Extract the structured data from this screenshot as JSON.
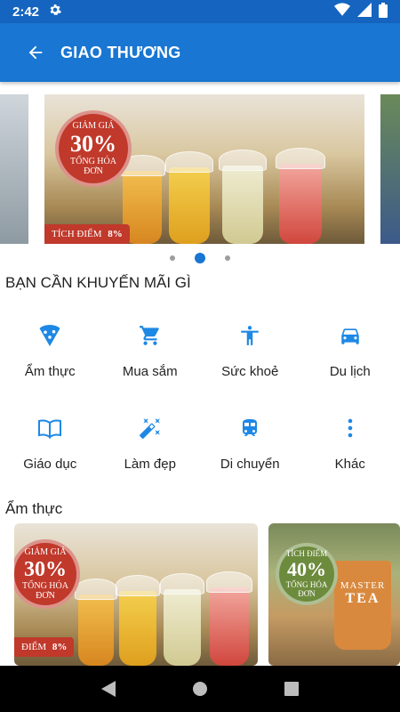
{
  "status_bar": {
    "time": "2:42",
    "icons": [
      "gear-icon",
      "wifi-icon",
      "signal-icon",
      "battery-icon"
    ]
  },
  "app_bar": {
    "title": "GIAO THƯƠNG",
    "back_icon": "arrow-back-icon"
  },
  "colors": {
    "primary": "#1976d2",
    "primary_dark": "#1565c0",
    "icon_blue": "#1e88e5",
    "promo_red": "#c0392b",
    "promo_green": "#6d8b3d"
  },
  "carousel": {
    "slide_count": 3,
    "active_index": 1,
    "banner": {
      "badge_line1": "GIẢM GIÁ",
      "badge_value": "30%",
      "badge_line3": "TỔNG HÓA",
      "badge_line4": "ĐƠN",
      "tag_label": "TÍCH ĐIỂM",
      "tag_value": "8%"
    }
  },
  "categories_section": {
    "title": "BẠN CẦN KHUYẾN MÃI GÌ",
    "items": [
      {
        "label": "Ẩm thực",
        "icon": "pizza-icon"
      },
      {
        "label": "Mua sắm",
        "icon": "cart-icon"
      },
      {
        "label": "Sức khoẻ",
        "icon": "person-icon"
      },
      {
        "label": "Du lịch",
        "icon": "car-icon"
      },
      {
        "label": "Giáo dục",
        "icon": "book-icon"
      },
      {
        "label": "Làm đẹp",
        "icon": "magic-wand-icon"
      },
      {
        "label": "Di chuyển",
        "icon": "train-icon"
      },
      {
        "label": "Khác",
        "icon": "more-vert-icon"
      }
    ]
  },
  "food_section": {
    "title": "Ẩm thực",
    "cards": [
      {
        "badge_line1": "GIẢM GIÁ",
        "badge_value": "30%",
        "badge_line3": "TỔNG HÓA",
        "badge_line4": "ĐƠN",
        "tag_label": "ĐIỂM",
        "tag_value": "8%"
      },
      {
        "badge_line1": "TÍCH ĐIỂM",
        "badge_value": "40%",
        "badge_line3": "TỔNG HÓA",
        "badge_line4": "ĐƠN",
        "brand_top": "MASTER",
        "brand_bottom": "TEA"
      }
    ]
  },
  "nav_bar": {
    "buttons": [
      "back-triangle-icon",
      "home-circle-icon",
      "recents-square-icon"
    ]
  }
}
